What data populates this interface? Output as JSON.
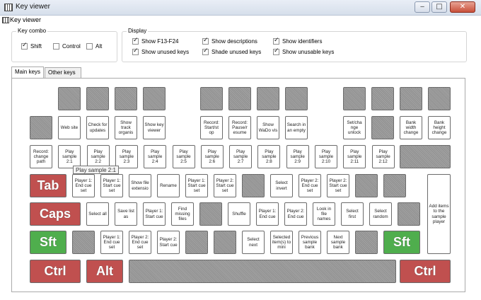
{
  "window": {
    "title": "Key viewer"
  },
  "menubar": {
    "label": "Key viewer"
  },
  "key_combo": {
    "label": "Key combo",
    "options": [
      {
        "label": "Shift",
        "checked": true
      },
      {
        "label": "Control",
        "checked": false
      },
      {
        "label": "Alt",
        "checked": false
      }
    ]
  },
  "display": {
    "label": "Display",
    "options": [
      {
        "label": "Show F13-F24",
        "checked": true
      },
      {
        "label": "Show descriptions",
        "checked": true
      },
      {
        "label": "Show identifiers",
        "checked": true
      },
      {
        "label": "Show unused keys",
        "checked": true
      },
      {
        "label": "Shade unused keys",
        "checked": true
      },
      {
        "label": "Show unusable keys",
        "checked": true
      }
    ]
  },
  "tabs": [
    {
      "label": "Main keys"
    },
    {
      "label": "Other keys"
    }
  ],
  "keyboard": {
    "row_f": [
      {
        "label": "",
        "style": "grey"
      },
      {
        "label": "",
        "style": "grey"
      },
      {
        "label": "",
        "style": "grey"
      },
      {
        "label": "",
        "style": "grey"
      },
      {
        "label": "",
        "style": "grey"
      },
      {
        "label": "",
        "style": "grey"
      },
      {
        "label": "",
        "style": "grey"
      },
      {
        "label": "",
        "style": "grey"
      },
      {
        "label": "",
        "style": "grey"
      },
      {
        "label": "",
        "style": "grey"
      },
      {
        "label": "",
        "style": "grey"
      },
      {
        "label": "",
        "style": "grey"
      }
    ],
    "row_fn": [
      {
        "label": "",
        "style": "grey"
      },
      {
        "label": "Web site",
        "style": "white"
      },
      {
        "label": "Check for updates",
        "style": "white"
      },
      {
        "label": "Show track organis",
        "style": "white"
      },
      {
        "label": "Show key viewer",
        "style": "white"
      },
      {
        "label": "Record: Start/st op",
        "style": "white"
      },
      {
        "label": "Record: Pause/r esume",
        "style": "white"
      },
      {
        "label": "Show WaDo vis",
        "style": "white"
      },
      {
        "label": "Search in an empty",
        "style": "white"
      },
      {
        "label": "Set/cha nge unlock",
        "style": "white"
      },
      {
        "label": "",
        "style": "grey"
      },
      {
        "label": "Bank width change",
        "style": "white"
      },
      {
        "label": "Bank height change",
        "style": "white"
      }
    ],
    "row_num": [
      {
        "label": "Record: change path",
        "style": "white"
      },
      {
        "label": "Play sample 2:1",
        "style": "white"
      },
      {
        "label": "Play sample 2:2",
        "style": "white"
      },
      {
        "label": "Play sample 2:3",
        "style": "white"
      },
      {
        "label": "Play sample 2:4",
        "style": "white"
      },
      {
        "label": "Play sample 2:5",
        "style": "white"
      },
      {
        "label": "Play sample 2:6",
        "style": "white"
      },
      {
        "label": "Play sample 2:7",
        "style": "white"
      },
      {
        "label": "Play sample 2:8",
        "style": "white"
      },
      {
        "label": "Play sample 2:9",
        "style": "white"
      },
      {
        "label": "Play sample 2:10",
        "style": "white"
      },
      {
        "label": "Play sample 2:11",
        "style": "white"
      },
      {
        "label": "Play sample 2:12",
        "style": "white"
      }
    ],
    "row_q": [
      {
        "label": "Tab",
        "style": "red"
      },
      {
        "label": "Player 1: End cue set",
        "style": "white"
      },
      {
        "label": "Player 1: Start cue set",
        "style": "white"
      },
      {
        "label": "Show file extensio",
        "style": "white"
      },
      {
        "label": "Rename",
        "style": "white"
      },
      {
        "label": "Player 1: Start cue set",
        "style": "white"
      },
      {
        "label": "Player 2: Start cue set",
        "style": "white"
      },
      {
        "label": "",
        "style": "grey"
      },
      {
        "label": "Select invert",
        "style": "white"
      },
      {
        "label": "Player 2: End cue set",
        "style": "white"
      },
      {
        "label": "Player 2: Start cue set",
        "style": "white"
      },
      {
        "label": "",
        "style": "grey"
      },
      {
        "label": "",
        "style": "grey"
      }
    ],
    "row_a": [
      {
        "label": "Caps",
        "style": "red"
      },
      {
        "label": "Select all",
        "style": "white"
      },
      {
        "label": "Save list as",
        "style": "white"
      },
      {
        "label": "Player 1: Start cue",
        "style": "white"
      },
      {
        "label": "Find missing files",
        "style": "white"
      },
      {
        "label": "",
        "style": "grey"
      },
      {
        "label": "Shuffle",
        "style": "white"
      },
      {
        "label": "Player 1: End cue",
        "style": "white"
      },
      {
        "label": "Player 2: End cue",
        "style": "white"
      },
      {
        "label": "Look in file names",
        "style": "white"
      },
      {
        "label": "Select first",
        "style": "white"
      },
      {
        "label": "Select random",
        "style": "white"
      },
      {
        "label": "",
        "style": "grey"
      }
    ],
    "row_z": [
      {
        "label": "Sft",
        "style": "green"
      },
      {
        "label": "",
        "style": "grey"
      },
      {
        "label": "Player 1: End cue set",
        "style": "white"
      },
      {
        "label": "Player 2: End cue set",
        "style": "white"
      },
      {
        "label": "Player 2: Start cue",
        "style": "white"
      },
      {
        "label": "",
        "style": "grey"
      },
      {
        "label": "",
        "style": "grey"
      },
      {
        "label": "Select next",
        "style": "white"
      },
      {
        "label": "Selected item(s) to mini",
        "style": "white"
      },
      {
        "label": "Previous sample bank",
        "style": "white"
      },
      {
        "label": "Next sample bank",
        "style": "white"
      },
      {
        "label": "",
        "style": "grey"
      },
      {
        "label": "Sft",
        "style": "green"
      }
    ],
    "row_bottom": [
      {
        "label": "Ctrl",
        "style": "red"
      },
      {
        "label": "Alt",
        "style": "red"
      },
      {
        "label": "",
        "style": "grey"
      },
      {
        "label": "Ctrl",
        "style": "red"
      }
    ],
    "enter_key": {
      "label": "Add items to the sample player"
    },
    "backspace_key": {
      "label": "",
      "style": "grey"
    }
  },
  "tooltip": {
    "text": "Play sample 2:1"
  }
}
